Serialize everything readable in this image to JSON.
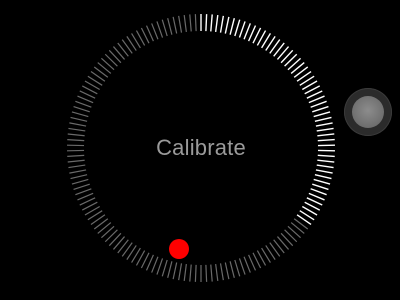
{
  "calibration": {
    "instruction": "Calibrate",
    "total_ticks": 150,
    "filled_fraction": 0.35
  },
  "colors": {
    "background": "#000000",
    "tick_filled": "#ffffff",
    "tick_empty": "#6a6a6a",
    "text": "#9a9a9a",
    "indicator": "#ff0000"
  },
  "icons": {
    "assistive_touch": "assistive-touch-icon"
  }
}
